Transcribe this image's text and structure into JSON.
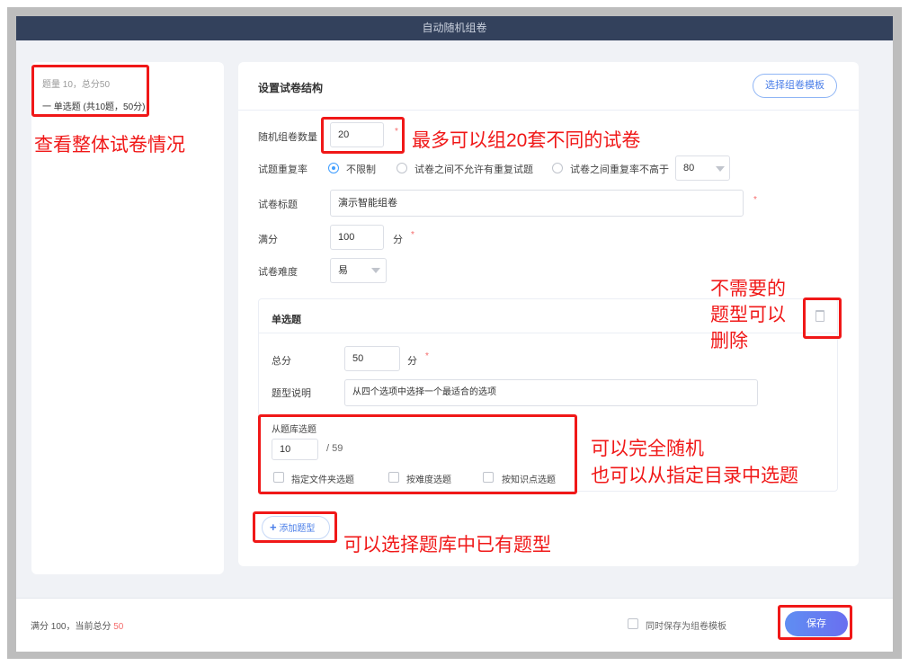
{
  "window_title": "自动随机组卷",
  "summary": {
    "stats": "题量 10，总分50",
    "section": "一 单选题 (共10题，50分)"
  },
  "form": {
    "title": "设置试卷结构",
    "template_button": "选择组卷模板",
    "count_label": "随机组卷数量",
    "count_value": "20",
    "repeat_label": "试题重复率",
    "repeat_options": [
      "不限制",
      "试卷之间不允许有重复试题",
      "试卷之间重复率不高于"
    ],
    "repeat_selected": 0,
    "repeat_rate_value": "80",
    "paper_title_label": "试卷标题",
    "paper_title_value": "演示智能组卷",
    "full_score_label": "满分",
    "full_score_value": "100",
    "unit": "分",
    "difficulty_label": "试卷难度",
    "difficulty_value": "易"
  },
  "section": {
    "title": "单选题",
    "total_label": "总分",
    "total_value": "50",
    "unit": "分",
    "desc_label": "题型说明",
    "desc_value": "从四个选项中选择一个最适合的选项",
    "bank_label": "从题库选题",
    "bank_value": "10",
    "bank_total": "/ 59",
    "checkboxes": [
      "指定文件夹选题",
      "按难度选题",
      "按知识点选题"
    ]
  },
  "add_type_button": "添加题型",
  "footer": {
    "score_text": "满分 100，当前总分 ",
    "current_score": "50",
    "save_template_label": "同时保存为组卷模板",
    "save_button": "保存"
  },
  "annotations": {
    "overview": "查看整体试卷情况",
    "max_sets": "最多可以组20套不同的试卷",
    "delete": [
      "不需要的",
      "题型可以",
      "删除"
    ],
    "random": [
      "可以完全随机",
      "也可以从指定目录中选题"
    ],
    "add_type": "可以选择题库中已有题型"
  }
}
